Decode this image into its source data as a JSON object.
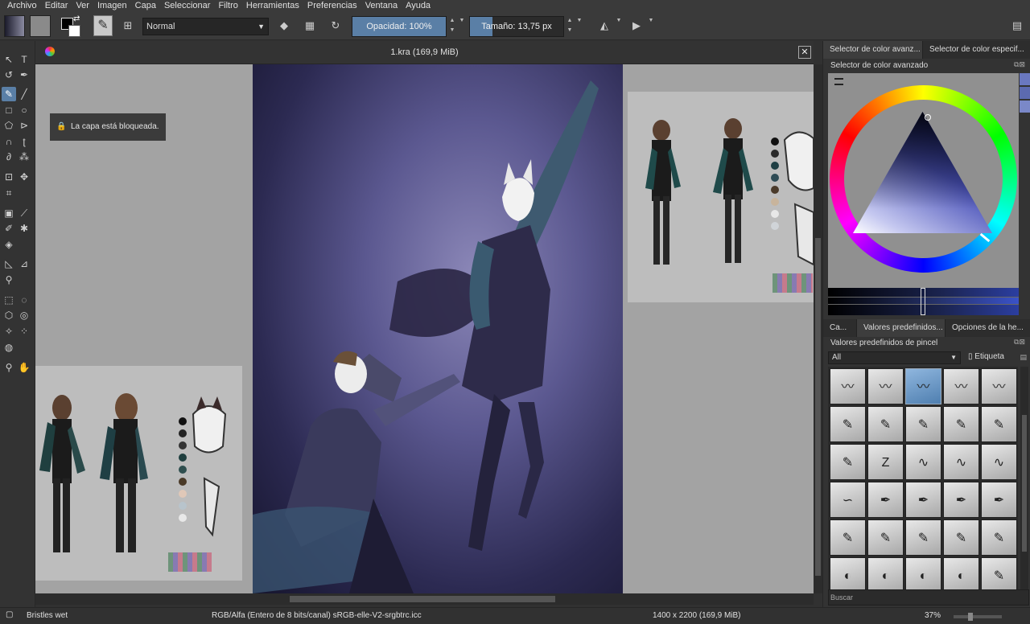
{
  "menu": [
    "Archivo",
    "Editar",
    "Ver",
    "Imagen",
    "Capa",
    "Seleccionar",
    "Filtro",
    "Herramientas",
    "Preferencias",
    "Ventana",
    "Ayuda"
  ],
  "toolbar": {
    "blend_mode": "Normal",
    "opacity_label": "Opacidad:  100%",
    "opacity_percent": 100,
    "size_label": "Tamaño:  13,75 px",
    "icons": [
      "eraser-icon",
      "alpha-lock-icon",
      "reload-preset-icon",
      "mirror-horizontal-icon",
      "mirror-vertical-icon",
      "workspace-icon"
    ]
  },
  "document": {
    "title": "1.kra (169,9 MiB)",
    "lock_message": "La capa está bloqueada."
  },
  "dock": {
    "top_tabs": [
      "Selector de color avanz...",
      "Selector de color especif..."
    ],
    "color_panel_title": "Selector de color avanzado",
    "bottom_tabs": [
      "Ca...",
      "Valores predefinidos...",
      "Opciones de la he..."
    ],
    "presets_title": "Valores predefinidos de pincel",
    "filter_value": "All",
    "tag_label": "Etiqueta",
    "search_placeholder": "Buscar"
  },
  "status": {
    "preset_name": "Bristles wet",
    "color_info": "RGB/Alfa (Entero de 8 bits/canal)  sRGB-elle-V2-srgbtrc.icc",
    "dimensions": "1400 x 2200 (169,9 MiB)",
    "zoom": "37%"
  },
  "colors": {
    "accent": "#5a7fa6",
    "panel_bg": "#333333",
    "canvas_bg": "#a3a3a3"
  },
  "palette_left": [
    "#111111",
    "#222222",
    "#333333",
    "#1f3f3f",
    "#2f4f4f",
    "#4a3a28",
    "#e0c8b8",
    "#b8c4cc",
    "#e8e8e8"
  ],
  "palette_right": [
    "#111111",
    "#2a2a2a",
    "#1f3f44",
    "#2e4b55",
    "#4a3a2a",
    "#c8b49c",
    "#e8e8e8",
    "#d0d4d8"
  ]
}
